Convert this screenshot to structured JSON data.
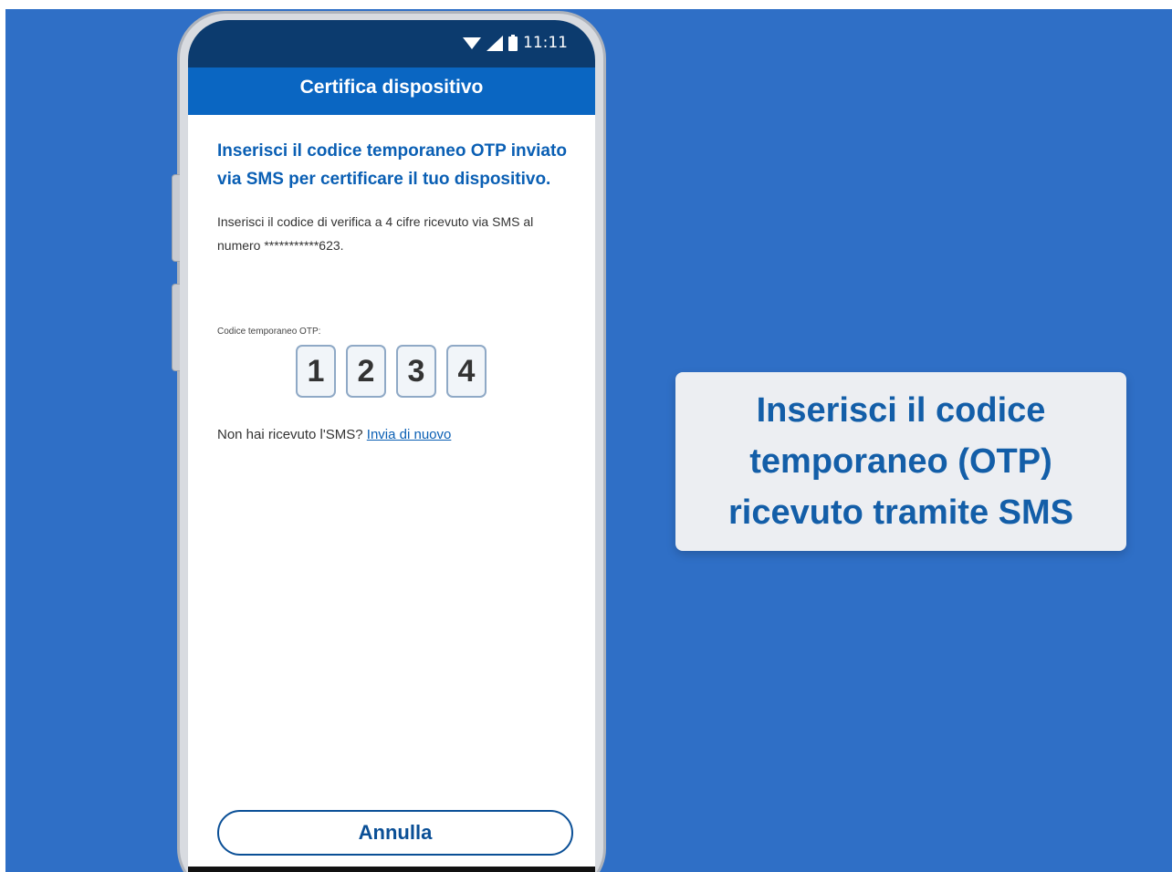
{
  "status_bar": {
    "time": "11:11"
  },
  "app_bar": {
    "title": "Certifica dispositivo"
  },
  "content": {
    "heading": "Inserisci il codice temporaneo OTP inviato via SMS per certificare il tuo dispositivo.",
    "description": "Inserisci il codice di verifica a 4 cifre ricevuto via SMS al numero ***********623.",
    "otp_label": "Codice temporaneo OTP:",
    "otp_digits": [
      "1",
      "2",
      "3",
      "4"
    ],
    "resend_prefix": "Non hai ricevuto l'SMS?",
    "resend_link": "Invia di nuovo"
  },
  "footer": {
    "cancel_label": "Annulla"
  },
  "caption": {
    "text": "Inserisci il codice temporaneo (OTP) ricevuto tramite SMS"
  },
  "colors": {
    "background": "#2f6fc6",
    "status_bar": "#0c3b6e",
    "app_bar": "#0a66c2",
    "accent_text": "#0a5fb4"
  }
}
